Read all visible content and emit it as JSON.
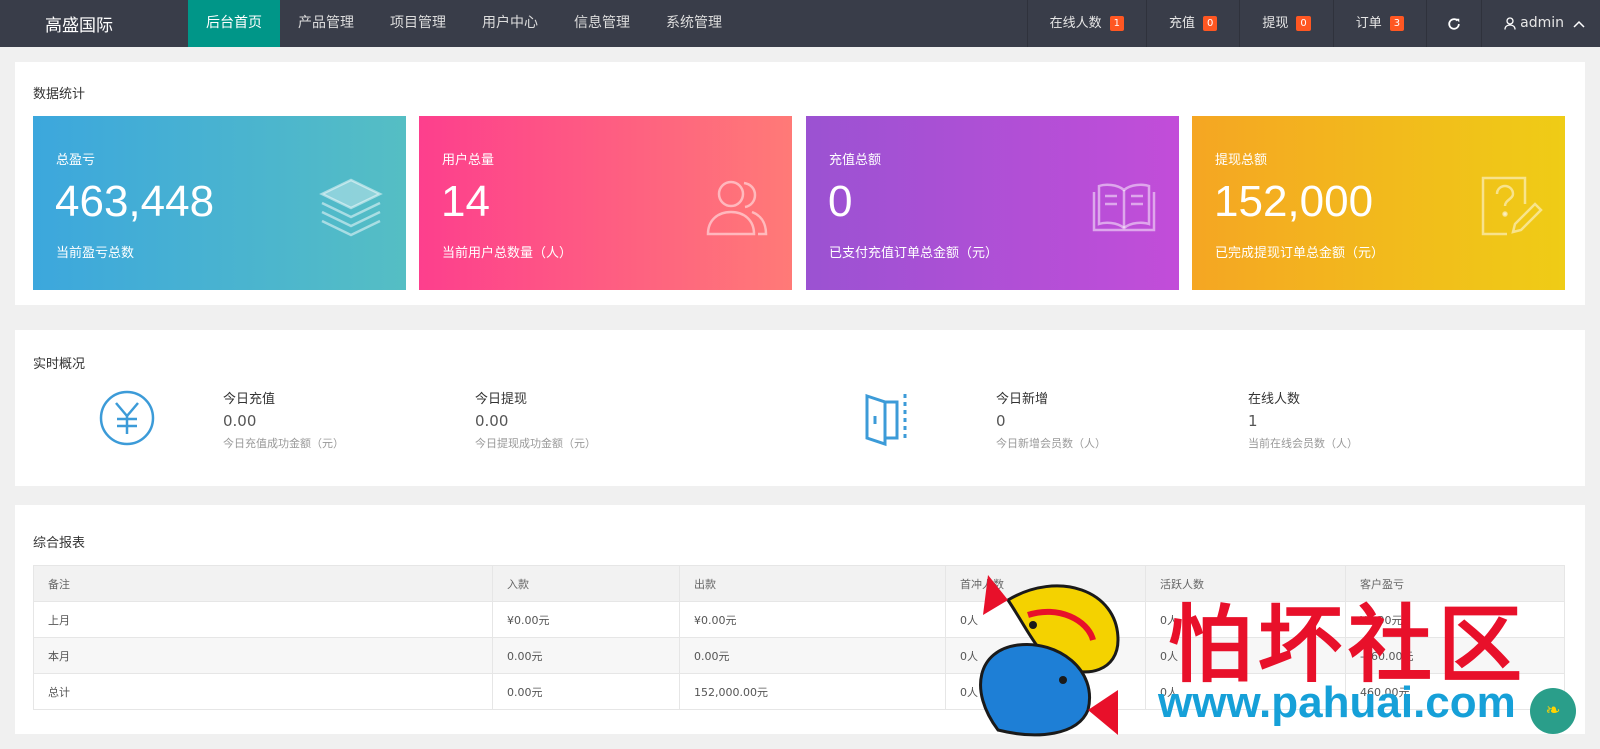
{
  "nav": {
    "logo": "高盛国际",
    "items": [
      "后台首页",
      "产品管理",
      "项目管理",
      "用户中心",
      "信息管理",
      "系统管理"
    ],
    "right": {
      "online_label": "在线人数",
      "online_count": "1",
      "recharge_label": "充值",
      "recharge_count": "0",
      "withdraw_label": "提现",
      "withdraw_count": "0",
      "order_label": "订单",
      "order_count": "3",
      "user_name": "admin"
    }
  },
  "stats": {
    "title": "数据统计",
    "cards": [
      {
        "label": "总盈亏",
        "value": "463,448",
        "sub": "当前盈亏总数",
        "icon": "layers-icon"
      },
      {
        "label": "用户总量",
        "value": "14",
        "sub": "当前用户总数量（人）",
        "icon": "users-icon"
      },
      {
        "label": "充值总额",
        "value": "0",
        "sub": "已支付充值订单总金额（元）",
        "icon": "book-icon"
      },
      {
        "label": "提现总额",
        "value": "152,000",
        "sub": "已完成提现订单总金额（元）",
        "icon": "question-edit-icon"
      }
    ]
  },
  "realtime": {
    "title": "实时概况",
    "items": [
      {
        "label": "今日充值",
        "value": "0.00",
        "sub": "今日充值成功金额（元）"
      },
      {
        "label": "今日提现",
        "value": "0.00",
        "sub": "今日提现成功金额（元）"
      },
      {
        "label": "今日新增",
        "value": "0",
        "sub": "今日新增会员数（人）"
      },
      {
        "label": "在线人数",
        "value": "1",
        "sub": "当前在线会员数（人）"
      }
    ]
  },
  "report": {
    "title": "综合报表",
    "headers": [
      "备注",
      "入款",
      "出款",
      "首冲人数",
      "活跃人数",
      "客户盈亏"
    ],
    "rows": [
      [
        "上月",
        "¥0.00元",
        "¥0.00元",
        "0人",
        "0人",
        "¥0.00元"
      ],
      [
        "本月",
        "0.00元",
        "0.00元",
        "0人",
        "0人",
        "-460.00元"
      ],
      [
        "总计",
        "0.00元",
        "152,000.00元",
        "0人",
        "0人",
        "460.00元"
      ]
    ]
  },
  "watermark": {
    "text": "怕坏社区",
    "url": "www.pahuai.com"
  },
  "colors": {
    "nav_bg": "#393d49",
    "active": "#009688",
    "badge": "#ff5722"
  }
}
